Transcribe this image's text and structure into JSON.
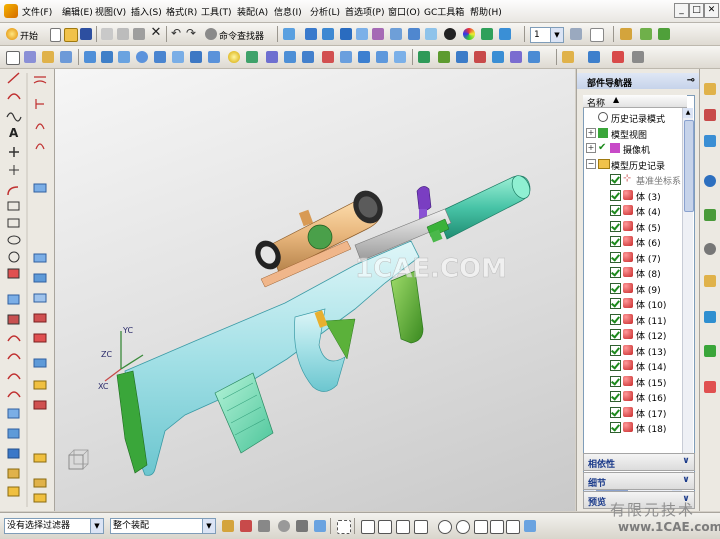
{
  "menubar": {
    "items": [
      "文件(F)",
      "编辑(E)",
      "视图(V)",
      "插入(S)",
      "格式(R)",
      "工具(T)",
      "装配(A)",
      "信息(I)",
      "分析(L)",
      "首选项(P)",
      "窗口(O)",
      "GC工具箱",
      "帮助(H)"
    ],
    "window_buttons": [
      "_",
      "□",
      "✕"
    ]
  },
  "toolbar": {
    "start_label": "开始",
    "command_finder_label": "命令查找器",
    "layer_value": "1"
  },
  "viewport": {
    "axes": {
      "yc": "YC",
      "zc": "ZC",
      "xc": "XC"
    },
    "watermark": "1CAE.COM"
  },
  "navigator": {
    "title": "部件导航器",
    "column_header": "名称",
    "items": [
      {
        "label": "历史记录模式"
      },
      {
        "label": "模型视图"
      },
      {
        "label": "摄像机"
      },
      {
        "label": "模型历史记录"
      },
      {
        "label": "基准坐标系 (0)"
      },
      {
        "label": "体 (3)"
      },
      {
        "label": "体 (4)"
      },
      {
        "label": "体 (5)"
      },
      {
        "label": "体 (6)"
      },
      {
        "label": "体 (7)"
      },
      {
        "label": "体 (8)"
      },
      {
        "label": "体 (9)"
      },
      {
        "label": "体 (10)"
      },
      {
        "label": "体 (11)"
      },
      {
        "label": "体 (12)"
      },
      {
        "label": "体 (13)"
      },
      {
        "label": "体 (14)"
      },
      {
        "label": "体 (15)"
      },
      {
        "label": "体 (16)"
      },
      {
        "label": "体 (17)"
      },
      {
        "label": "体 (18)"
      }
    ],
    "panels": [
      "相依性",
      "细节",
      "预览"
    ]
  },
  "statusbar": {
    "filter_value": "没有选择过滤器",
    "scope_value": "整个装配"
  },
  "watermark": {
    "text": "有限元技术",
    "url": "www.1CAE.com"
  },
  "colors": {
    "body": "#a3e0e6",
    "accent_green": "#3aa63a",
    "grip_green": "#5bb13a",
    "scope_tan": "#e8b67c",
    "muzzle_teal": "#48c4a7",
    "purple": "#7a3ec2"
  }
}
